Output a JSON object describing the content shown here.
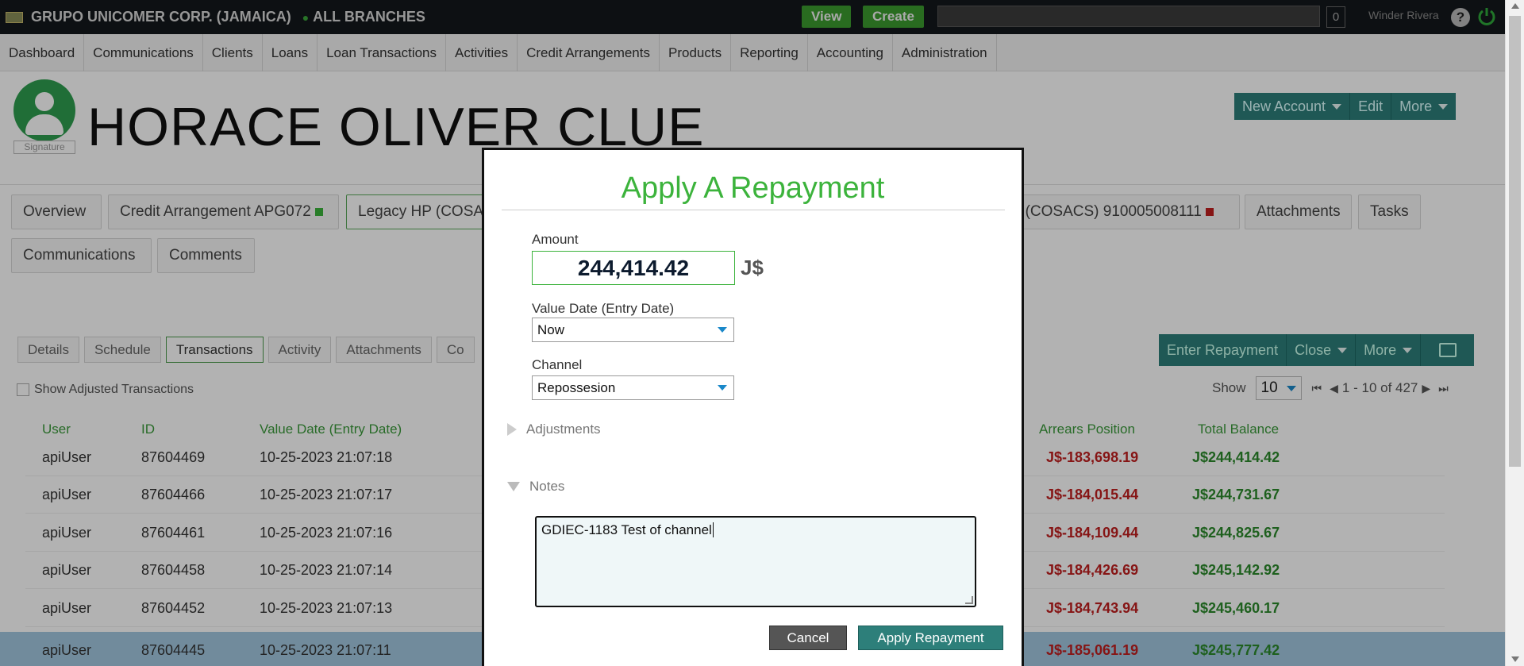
{
  "topbar": {
    "org_name": "GRUPO UNICOMER CORP. (JAMAICA)",
    "branches": "ALL BRANCHES",
    "view_label": "View",
    "create_label": "Create",
    "counter": "0",
    "user_name": "Winder Rivera",
    "help_icon": "?",
    "power_icon": "power-icon"
  },
  "menu": [
    "Dashboard",
    "Communications",
    "Clients",
    "Loans",
    "Loan Transactions",
    "Activities",
    "Credit Arrangements",
    "Products",
    "Reporting",
    "Accounting",
    "Administration"
  ],
  "client": {
    "name": "HORACE OLIVER CLUE",
    "signature_label": "Signature",
    "new_account_label": "New Account",
    "edit_label": "Edit",
    "more_label": "More"
  },
  "account_tabs": {
    "overview": "Overview",
    "credit_arrangement": "Credit Arrangement APG072",
    "legacy_hp": "Legacy HP (COSA",
    "legacy_hp2": "P (COSACS) 910005008111",
    "attachments": "Attachments",
    "tasks": "Tasks",
    "communications": "Communications",
    "comments": "Comments",
    "status_colors": {
      "green": "#3cb33c",
      "red": "#c01f1f"
    }
  },
  "sub_tabs": [
    "Details",
    "Schedule",
    "Transactions",
    "Activity",
    "Attachments",
    "Co"
  ],
  "actions": {
    "enter_repayment": "Enter Repayment",
    "close": "Close",
    "more": "More",
    "print_icon": "printer-icon"
  },
  "transactions": {
    "show_adjusted": "Show Adjusted Transactions",
    "show_label": "Show",
    "page_size": "10",
    "page_range": "1 - 10 of 427",
    "columns": {
      "user": "User",
      "id": "ID",
      "value_date": "Value Date (Entry Date)",
      "arrears": "Arrears Position",
      "total_balance": "Total Balance"
    },
    "rows": [
      {
        "user": "apiUser",
        "id": "87604469",
        "date": "10-25-2023 21:07:18",
        "arrears": "J$-183,698.19",
        "balance": "J$244,414.42"
      },
      {
        "user": "apiUser",
        "id": "87604466",
        "date": "10-25-2023 21:07:17",
        "arrears": "J$-184,015.44",
        "balance": "J$244,731.67"
      },
      {
        "user": "apiUser",
        "id": "87604461",
        "date": "10-25-2023 21:07:16",
        "arrears": "J$-184,109.44",
        "balance": "J$244,825.67"
      },
      {
        "user": "apiUser",
        "id": "87604458",
        "date": "10-25-2023 21:07:14",
        "arrears": "J$-184,426.69",
        "balance": "J$245,142.92"
      },
      {
        "user": "apiUser",
        "id": "87604452",
        "date": "10-25-2023 21:07:13",
        "arrears": "J$-184,743.94",
        "balance": "J$245,460.17"
      },
      {
        "user": "apiUser",
        "id": "87604445",
        "date": "10-25-2023 21:07:11",
        "arrears": "J$-185,061.19",
        "balance": "J$245,777.42"
      }
    ]
  },
  "modal": {
    "title": "Apply A Repayment",
    "amount_label": "Amount",
    "amount_value": "244,414.42",
    "currency": "J$",
    "value_date_label": "Value Date (Entry Date)",
    "value_date_value": "Now",
    "channel_label": "Channel",
    "channel_value": "Repossesion",
    "adjustments_label": "Adjustments",
    "notes_label": "Notes",
    "notes_value": "GDIEC-1183 Test of channel",
    "cancel_label": "Cancel",
    "apply_label": "Apply Repayment",
    "accent_color": "#3cb33c"
  }
}
